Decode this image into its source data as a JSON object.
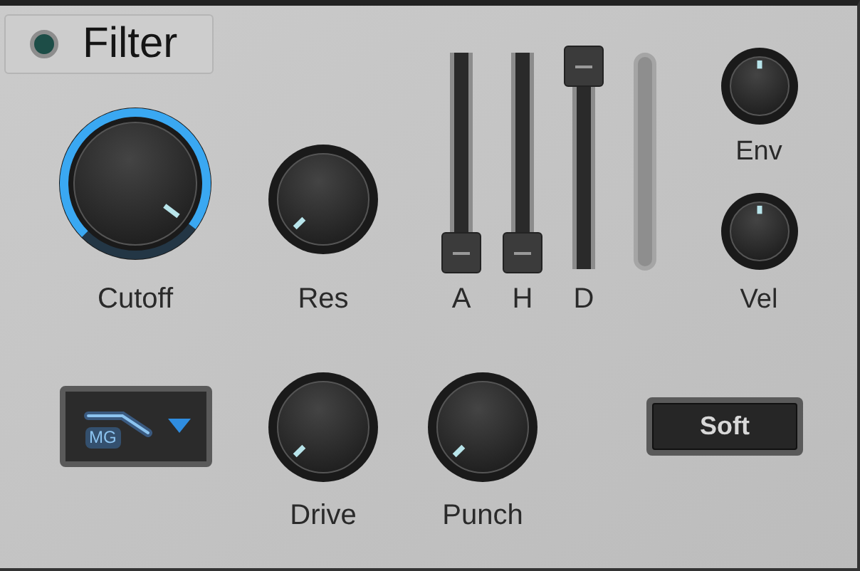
{
  "header": {
    "title": "Filter",
    "led_on": true
  },
  "main_knobs": [
    {
      "label": "Cutoff",
      "kind": "ring"
    },
    {
      "label": "Res",
      "kind": "plain"
    }
  ],
  "envelope_sliders": [
    {
      "label": "A",
      "level": 0
    },
    {
      "label": "H",
      "level": 0
    },
    {
      "label": "D",
      "level": 1
    }
  ],
  "mod_knobs": [
    {
      "label": "Env"
    },
    {
      "label": "Vel"
    }
  ],
  "filter_type": {
    "label": "MG"
  },
  "drive_knobs": [
    {
      "label": "Drive"
    },
    {
      "label": "Punch"
    }
  ],
  "mode_button": {
    "label": "Soft"
  }
}
